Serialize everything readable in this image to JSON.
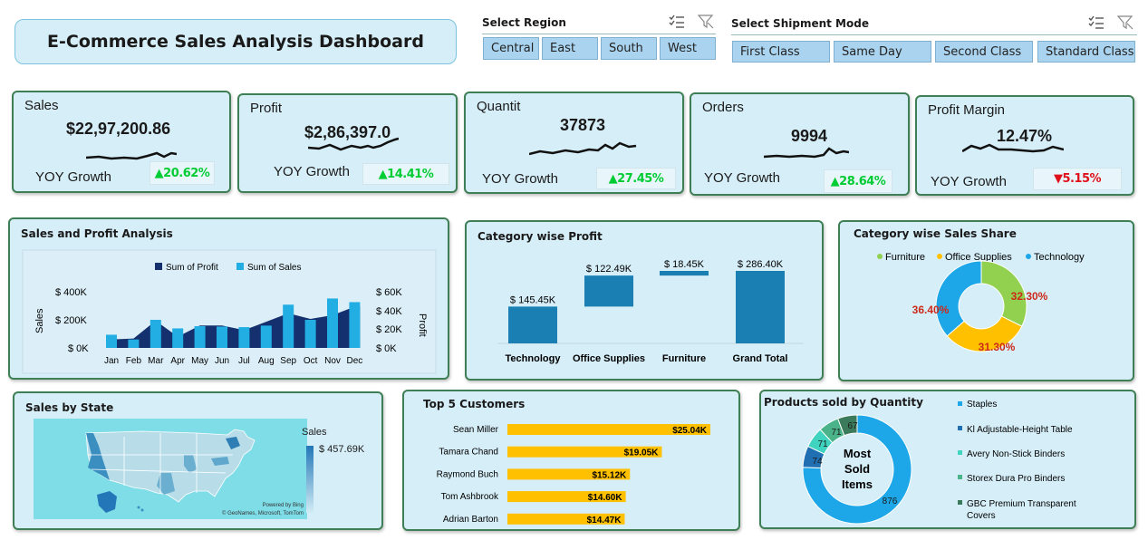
{
  "header": {
    "title": "E-Commerce Sales Analysis Dashboard"
  },
  "region_slicer": {
    "label": "Select Region",
    "options": [
      "Central",
      "East",
      "South",
      "West"
    ]
  },
  "shipment_slicer": {
    "label": "Select Shipment Mode",
    "options": [
      "First Class",
      "Same Day",
      "Second Class",
      "Standard Class"
    ]
  },
  "kpis": [
    {
      "label": "Sales",
      "value": "$22,97,200.86",
      "yoy_label": "YOY Growth",
      "growth": "20.62%",
      "direction": "up",
      "color": "#00cc33"
    },
    {
      "label": "Profit",
      "value": "$2,86,397.0",
      "yoy_label": "YOY Growth",
      "growth": "14.41%",
      "direction": "up",
      "color": "#00cc33"
    },
    {
      "label": "Quantit",
      "value": "37873",
      "yoy_label": "YOY Growth",
      "growth": "27.45%",
      "direction": "up",
      "color": "#00cc33"
    },
    {
      "label": "Orders",
      "value": "9994",
      "yoy_label": "YOY Growth",
      "growth": "28.64%",
      "direction": "up",
      "color": "#00cc33"
    },
    {
      "label": "Profit Margin",
      "value": "12.47%",
      "yoy_label": "YOY Growth",
      "growth": "5.15%",
      "direction": "down",
      "color": "#e0101a"
    }
  ],
  "sales_profit": {
    "title": "Sales and Profit Analysis",
    "legend": [
      "Sum of Profit",
      "Sum of Sales"
    ],
    "ylabel_left": "Sales",
    "ylabel_right": "Profit",
    "left_ticks": [
      "$ 400K",
      "$ 200K",
      "$ 0K"
    ],
    "right_ticks": [
      "$ 60K",
      "$ 40K",
      "$ 20K",
      "$ 0K"
    ]
  },
  "category_profit": {
    "title": "Category wise Profit",
    "labels": [
      "$ 145.45K",
      "$ 122.49K",
      "$ 18.45K",
      "$ 286.40K"
    ],
    "categories": [
      "Technology",
      "Office Supplies",
      "Furniture",
      "Grand Total"
    ]
  },
  "category_share": {
    "title": "Category wise Sales Share",
    "legend": [
      "Furniture",
      "Office Supplies",
      "Technology"
    ],
    "labels": [
      "32.30%",
      "31.30%",
      "36.40%"
    ]
  },
  "sales_by_state": {
    "title": "Sales by State",
    "legend_title": "Sales",
    "legend_value": "$ 457.69K",
    "attribution_1": "Powered by Bing",
    "attribution_2": "© GeoNames, Microsoft, TomTom"
  },
  "top_customers": {
    "title": "Top 5 Customers",
    "names": [
      "Sean Miller",
      "Tamara Chand",
      "Raymond Buch",
      "Tom Ashbrook",
      "Adrian Barton"
    ],
    "labels": [
      "$25.04K",
      "$19.05K",
      "$15.12K",
      "$14.60K",
      "$14.47K"
    ]
  },
  "products_qty": {
    "title": "Products sold by Quantity",
    "center_text": [
      "Most",
      "Sold",
      "Items"
    ],
    "legend": [
      "Staples",
      "Kl Adjustable-Height Table",
      "Avery Non-Stick Binders",
      "Storex Dura Pro Binders",
      "GBC Premium Transparent",
      "Covers"
    ],
    "labels": [
      "876",
      "74",
      "71",
      "71",
      "67"
    ]
  },
  "chart_data": [
    {
      "type": "bar",
      "title": "Sales and Profit Analysis",
      "categories": [
        "Jan",
        "Feb",
        "Mar",
        "Apr",
        "May",
        "Jun",
        "Jul",
        "Aug",
        "Sep",
        "Oct",
        "Nov",
        "Dec"
      ],
      "series": [
        {
          "name": "Sum of Profit",
          "axis": "right",
          "type": "area",
          "values": [
            9,
            10,
            29,
            12,
            24,
            24,
            19,
            28,
            37,
            31,
            35,
            44
          ]
        },
        {
          "name": "Sum of Sales",
          "axis": "left",
          "type": "bar",
          "values": [
            94,
            60,
            200,
            139,
            155,
            152,
            148,
            159,
            308,
            200,
            352,
            326
          ]
        }
      ],
      "ylabel": "Sales",
      "ylim": [
        0,
        400
      ],
      "y2label": "Profit",
      "y2lim": [
        0,
        60
      ],
      "colors": {
        "profit": "#14306e",
        "sales": "#22aee3"
      }
    },
    {
      "type": "bar",
      "title": "Category wise Profit",
      "categories": [
        "Technology",
        "Office Supplies",
        "Furniture",
        "Grand Total"
      ],
      "values": [
        145.45,
        122.49,
        18.45,
        286.4
      ],
      "waterfall": true,
      "color": "#1a80b4"
    },
    {
      "type": "pie",
      "title": "Category wise Sales Share",
      "categories": [
        "Furniture",
        "Office Supplies",
        "Technology"
      ],
      "values": [
        32.3,
        31.3,
        36.4
      ],
      "colors": [
        "#92d050",
        "#ffc000",
        "#1ea7e8"
      ]
    },
    {
      "type": "bar",
      "title": "Top 5 Customers",
      "categories": [
        "Sean Miller",
        "Tamara Chand",
        "Raymond Buch",
        "Tom Ashbrook",
        "Adrian Barton"
      ],
      "values": [
        25.04,
        19.05,
        15.12,
        14.6,
        14.47
      ],
      "orientation": "horizontal",
      "color": "#ffc000"
    },
    {
      "type": "pie",
      "title": "Products sold by Quantity",
      "categories": [
        "Staples",
        "Kl Adjustable-Height Table",
        "Avery Non-Stick Binders",
        "Storex Dura Pro Binders",
        "GBC Premium Transparent Covers"
      ],
      "values": [
        876,
        74,
        71,
        71,
        67
      ],
      "colors": [
        "#1ea7e8",
        "#1f6fb2",
        "#3fd3c0",
        "#4bb389",
        "#3b7a5a"
      ]
    }
  ]
}
